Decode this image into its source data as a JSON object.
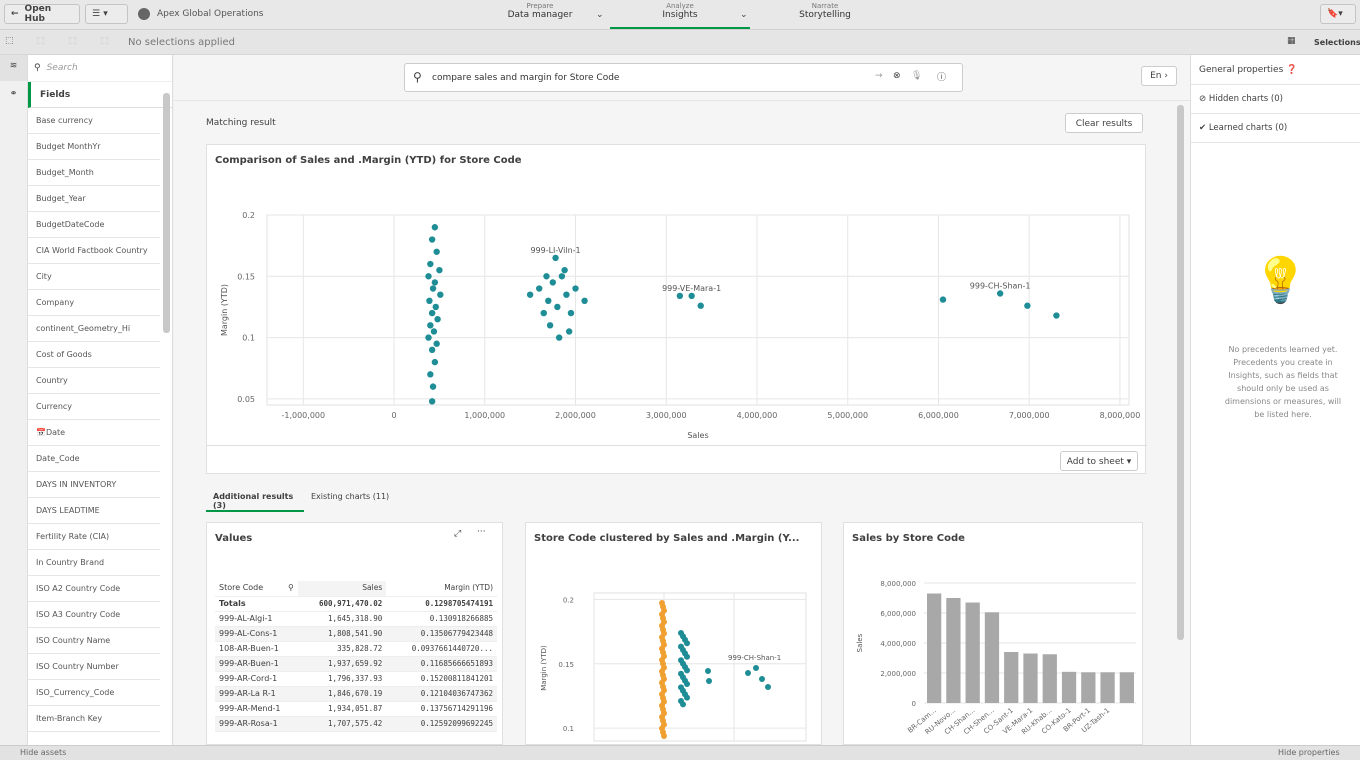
{
  "topbar": {
    "open_hub": "Open Hub",
    "app_title": "Apex Global Operations",
    "tabs": [
      {
        "sub": "Prepare",
        "label": "Data manager"
      },
      {
        "sub": "Analyze",
        "label": "Insights"
      },
      {
        "sub": "Narrate",
        "label": "Storytelling"
      }
    ]
  },
  "toolbar": {
    "selections_status": "No selections applied",
    "selections_label": "Selections"
  },
  "assets": {
    "search_placeholder": "Search",
    "fields_header": "Fields",
    "fields": [
      "Base currency",
      "Budget MonthYr",
      "Budget_Month",
      "Budget_Year",
      "BudgetDateCode",
      "CIA World Factbook Country",
      "City",
      "Company",
      "continent_Geometry_Hi",
      "Cost of Goods",
      "Country",
      "Currency",
      "Date",
      "Date_Code",
      "DAYS IN INVENTORY",
      "DAYS LEADTIME",
      "Fertility Rate (CIA)",
      "In Country Brand",
      "ISO A2 Country Code",
      "ISO A3 Country Code",
      "ISO Country Name",
      "ISO Country Number",
      "ISO_Currency_Code",
      "Item-Branch Key"
    ]
  },
  "search": {
    "query": "compare sales and margin for Store Code",
    "lang": "En"
  },
  "results": {
    "matching_label": "Matching result",
    "clear_label": "Clear results",
    "add_to_sheet": "Add to sheet",
    "tabs": [
      "Additional results (3)",
      "Existing charts (11)"
    ]
  },
  "chart_data": [
    {
      "type": "scatter",
      "title": "Comparison of Sales and .Margin (YTD) for Store Code",
      "xlabel": "Sales",
      "ylabel": "Margin (YTD)",
      "xlim": [
        -1400000,
        8100000
      ],
      "ylim": [
        0.045,
        0.2
      ],
      "xticks": [
        "-1,000,000",
        "0",
        "1,000,000",
        "2,000,000",
        "3,000,000",
        "4,000,000",
        "5,000,000",
        "6,000,000",
        "7,000,000",
        "8,000,000"
      ],
      "yticks": [
        "0.05",
        "0.1",
        "0.15",
        "0.2"
      ],
      "color": "#1e8d96",
      "points": [
        [
          450000,
          0.19
        ],
        [
          420000,
          0.18
        ],
        [
          470000,
          0.17
        ],
        [
          400000,
          0.16
        ],
        [
          500000,
          0.155
        ],
        [
          380000,
          0.15
        ],
        [
          450000,
          0.145
        ],
        [
          430000,
          0.14
        ],
        [
          510000,
          0.135
        ],
        [
          390000,
          0.13
        ],
        [
          460000,
          0.125
        ],
        [
          420000,
          0.12
        ],
        [
          480000,
          0.115
        ],
        [
          400000,
          0.11
        ],
        [
          440000,
          0.105
        ],
        [
          380000,
          0.1
        ],
        [
          470000,
          0.095
        ],
        [
          420000,
          0.09
        ],
        [
          450000,
          0.08
        ],
        [
          400000,
          0.07
        ],
        [
          430000,
          0.06
        ],
        [
          420000,
          0.048
        ],
        [
          1500000,
          0.135
        ],
        [
          1600000,
          0.14
        ],
        [
          1700000,
          0.13
        ],
        [
          1750000,
          0.145
        ],
        [
          1800000,
          0.125
        ],
        [
          1850000,
          0.15
        ],
        [
          1900000,
          0.135
        ],
        [
          1950000,
          0.12
        ],
        [
          2000000,
          0.14
        ],
        [
          1650000,
          0.12
        ],
        [
          1720000,
          0.11
        ],
        [
          1820000,
          0.1
        ],
        [
          1880000,
          0.155
        ],
        [
          2100000,
          0.13
        ],
        [
          1780000,
          0.165
        ],
        [
          1680000,
          0.15
        ],
        [
          1930000,
          0.105
        ],
        [
          3150000,
          0.134
        ],
        [
          3280000,
          0.134
        ],
        [
          3380000,
          0.126
        ],
        [
          6050000,
          0.131
        ],
        [
          6680000,
          0.136
        ],
        [
          6980000,
          0.126
        ],
        [
          7300000,
          0.118
        ]
      ],
      "labels": [
        {
          "text": "999-LI-Viln-1",
          "x": 1780000,
          "y": 0.165
        },
        {
          "text": "999-VE-Mara-1",
          "x": 3280000,
          "y": 0.134
        },
        {
          "text": "999-CH-Shan-1",
          "x": 6680000,
          "y": 0.136
        }
      ]
    },
    {
      "type": "table",
      "title": "Values",
      "columns": [
        "Store Code",
        "Sales",
        "Margin (YTD)"
      ],
      "totals": [
        "Totals",
        "600,971,470.02",
        "0.1298705474191"
      ],
      "rows": [
        [
          "999-AL-Algi-1",
          "1,645,318.90",
          "0.130918266885"
        ],
        [
          "999-AL-Cons-1",
          "1,808,541.90",
          "0.13506779423448"
        ],
        [
          "108-AR-Buen-1",
          "335,828.72",
          "0.0937661440720..."
        ],
        [
          "999-AR-Buen-1",
          "1,937,659.92",
          "0.11685666651893"
        ],
        [
          "999-AR-Cord-1",
          "1,796,337.93",
          "0.15200811841201"
        ],
        [
          "999-AR-La R-1",
          "1,846,670.19",
          "0.12104036747362"
        ],
        [
          "999-AR-Mend-1",
          "1,934,051.87",
          "0.13756714291196"
        ],
        [
          "999-AR-Rosa-1",
          "1,707,575.42",
          "0.12592099692245"
        ]
      ]
    },
    {
      "type": "scatter",
      "title": "Store Code clustered by Sales and .Margin (Y...",
      "xlabel": "",
      "ylabel": "Margin (YTD)",
      "yticks": [
        "0.1",
        "0.15",
        "0.2"
      ],
      "ylim": [
        0.09,
        0.205
      ],
      "colors": [
        "#f0a030",
        "#1e8d96"
      ],
      "labels": [
        {
          "text": "999-CH-Shan-1"
        }
      ]
    },
    {
      "type": "bar",
      "title": "Sales by Store Code",
      "ylabel": "Sales",
      "ylim": [
        0,
        8000000
      ],
      "color": "#a8a8a8",
      "yticks": [
        "0",
        "2,000,000",
        "4,000,000",
        "6,000,000",
        "8,000,000"
      ],
      "categories": [
        "BR-Cam...",
        "RU-Novo...",
        "CH-Shan...",
        "CH-Shen...",
        "CO-Sant-1",
        "VE-Mara-1",
        "RU-Khab...",
        "CO-Kato-1",
        "BR-Port-1",
        "UZ-Tash-1",
        ""
      ],
      "values": [
        7300000,
        7000000,
        6700000,
        6050000,
        3400000,
        3300000,
        3250000,
        2080000,
        2050000,
        2050000,
        2050000
      ]
    }
  ],
  "properties": {
    "title": "General properties",
    "hidden": "Hidden charts (0)",
    "learned": "Learned charts (0)",
    "empty_text": "No precedents learned yet. Precedents you create in Insights, such as fields that should only be used as dimensions or measures, will be listed here."
  },
  "bottom": {
    "hide_assets": "Hide assets",
    "hide_properties": "Hide properties"
  }
}
